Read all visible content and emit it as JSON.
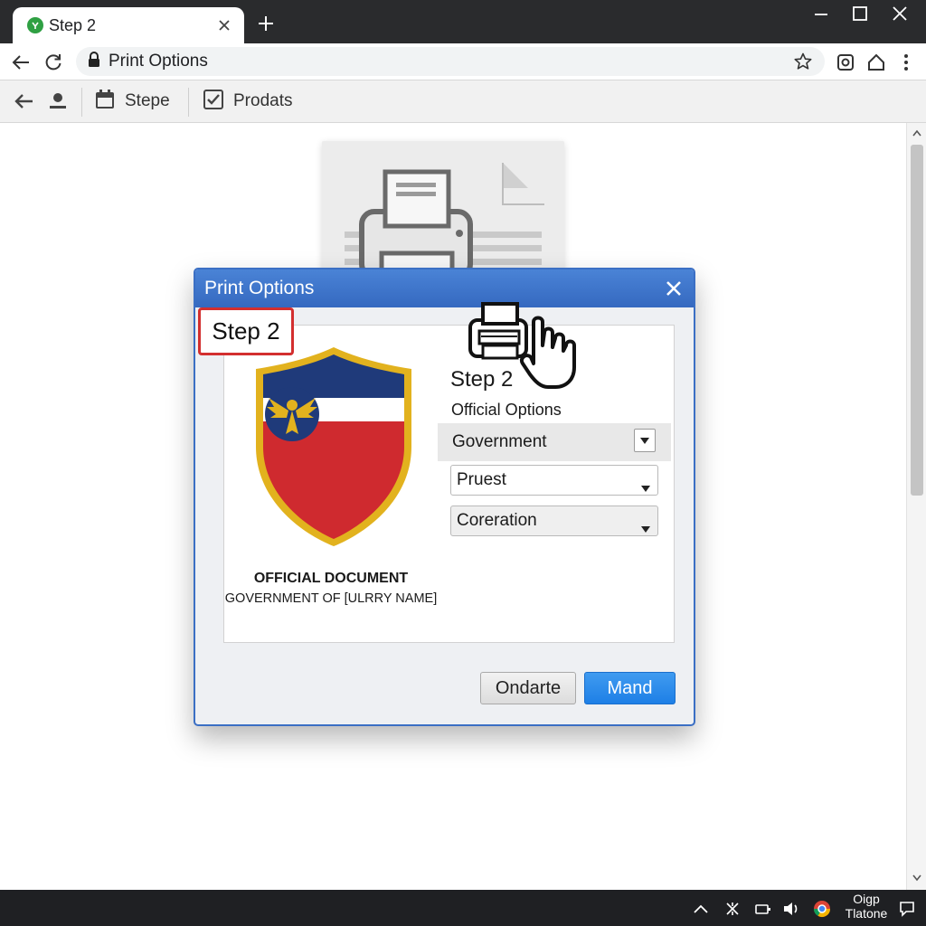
{
  "browser": {
    "tab_title": "Step 2",
    "address": "Print Options"
  },
  "toolbar": {
    "items": [
      {
        "label": "Stepe",
        "icon": "calendar-icon"
      },
      {
        "label": "Prodats",
        "icon": "checkbox-icon"
      }
    ]
  },
  "dialog": {
    "title": "Print Options",
    "step_badge": "Step 2",
    "document": {
      "title": "OFFICIAL DOCUMENT",
      "subtitle": "GOVERNMENT OF [ULRRY NAME]"
    },
    "heading": "Step 2",
    "options_label": "Official Options",
    "selects": [
      {
        "value": "Government"
      },
      {
        "value": "Pruest"
      },
      {
        "value": "Coreration"
      }
    ],
    "buttons": {
      "secondary": "Ondarte",
      "primary": "Mand"
    }
  },
  "taskbar": {
    "clock_line1": "Oigp",
    "clock_line2": "Tlatone"
  },
  "colors": {
    "dialog_title_bar": "#3b6fc4",
    "step_badge_border": "#d32f2f",
    "primary_button": "#1e7fe6",
    "shield_blue": "#1f3a7a",
    "shield_red": "#cf2a2f",
    "shield_gold": "#e2b21e"
  }
}
